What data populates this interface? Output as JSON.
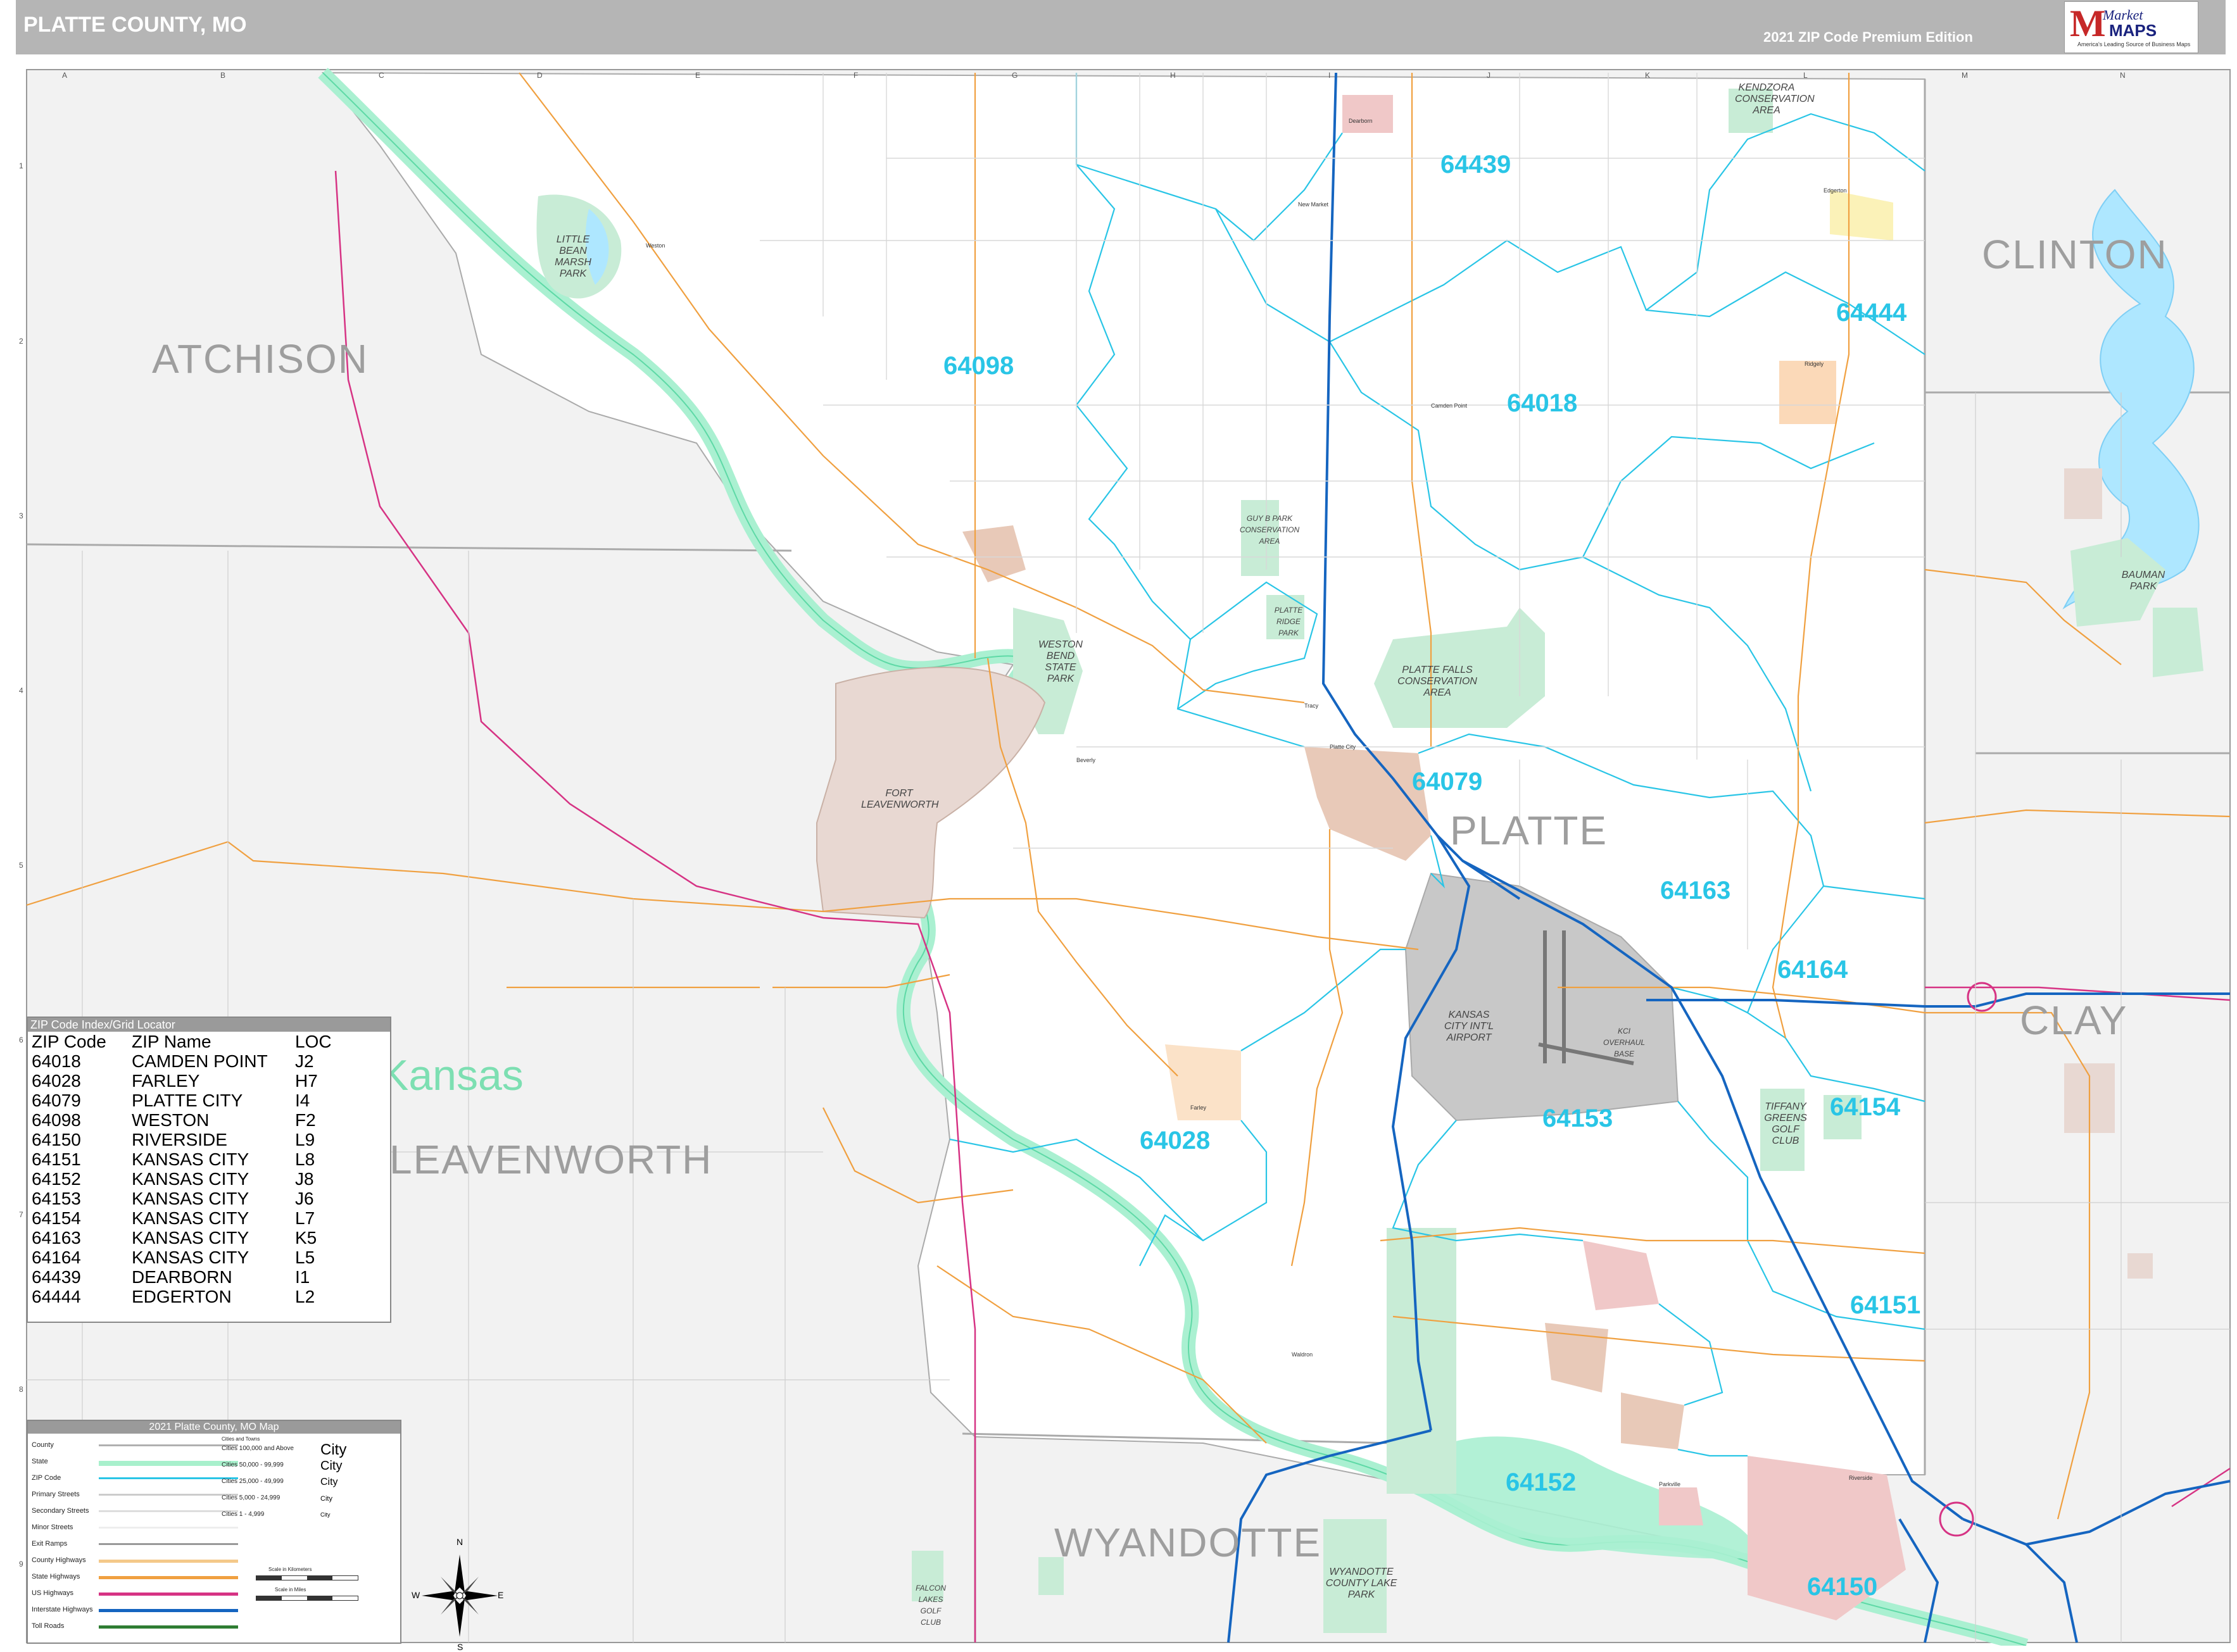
{
  "header": {
    "title": "PLATTE COUNTY, MO",
    "edition": "2021 ZIP Code Premium Edition",
    "logo": {
      "brand_top": "Market",
      "brand_bottom": "MAPS",
      "tagline": "America's Leading Source of Business Maps"
    }
  },
  "grid": {
    "columns": [
      "A",
      "B",
      "C",
      "D",
      "E",
      "F",
      "G",
      "H",
      "I",
      "J",
      "K",
      "L",
      "M",
      "N"
    ],
    "rows": [
      "1",
      "2",
      "3",
      "4",
      "5",
      "6",
      "7",
      "8",
      "9"
    ]
  },
  "counties": {
    "atchison": "ATCHISON",
    "clinton": "CLINTON",
    "platte": "PLATTE",
    "clay": "CLAY",
    "leavenworth": "LEAVENWORTH",
    "wyandotte": "WYANDOTTE"
  },
  "states": {
    "kansas": "Kansas"
  },
  "zip_labels": {
    "z64439": "64439",
    "z64444": "64444",
    "z64098": "64098",
    "z64018": "64018",
    "z64079": "64079",
    "z64163": "64163",
    "z64164": "64164",
    "z64153": "64153",
    "z64154": "64154",
    "z64028": "64028",
    "z64151": "64151",
    "z64152": "64152",
    "z64150": "64150"
  },
  "parks": {
    "kendzora": "KENDZORA CONSERVATION AREA",
    "little_bean": "LITTLE BEAN MARSH PARK",
    "guy_park": "GUY B PARK CONSERVATION AREA",
    "platte_ridge": "PLATTE RIDGE PARK",
    "weston_bend": "WESTON BEND STATE PARK",
    "platte_falls": "PLATTE FALLS CONSERVATION AREA",
    "fort_leavenworth": "FORT LEAVENWORTH",
    "baumann": "BAUMAN PARK",
    "airport": "KANSAS CITY INT'L AIRPORT",
    "kci_base": "KCI OVERHAUL BASE",
    "tiffany": "TIFFANY GREENS GOLF CLUB",
    "wyandotte_lake": "WYANDOTTE COUNTY LAKE PARK",
    "falcon_lakes": "FALCON LAKES GOLF CLUB"
  },
  "towns": {
    "dearborn": "Dearborn",
    "new_market": "New Market",
    "camden_point": "Camden Point",
    "edgerton": "Edgerton",
    "weston": "Weston",
    "beverly": "Beverly",
    "platte_city": "Platte City",
    "tracy": "Tracy",
    "farley": "Farley",
    "ridgely": "Ridgely",
    "waldron": "Waldron",
    "riverside": "Riverside",
    "parkville": "Parkville"
  },
  "zip_index": {
    "title": "ZIP Code Index/Grid Locator",
    "headers": [
      "ZIP Code",
      "ZIP Name",
      "LOC"
    ],
    "rows": [
      [
        "64018",
        "CAMDEN POINT",
        "J2"
      ],
      [
        "64028",
        "FARLEY",
        "H7"
      ],
      [
        "64079",
        "PLATTE CITY",
        "I4"
      ],
      [
        "64098",
        "WESTON",
        "F2"
      ],
      [
        "64150",
        "RIVERSIDE",
        "L9"
      ],
      [
        "64151",
        "KANSAS CITY",
        "L8"
      ],
      [
        "64152",
        "KANSAS CITY",
        "J8"
      ],
      [
        "64153",
        "KANSAS CITY",
        "J6"
      ],
      [
        "64154",
        "KANSAS CITY",
        "L7"
      ],
      [
        "64163",
        "KANSAS CITY",
        "K5"
      ],
      [
        "64164",
        "KANSAS CITY",
        "L5"
      ],
      [
        "64439",
        "DEARBORN",
        "I1"
      ],
      [
        "64444",
        "EDGERTON",
        "L2"
      ]
    ]
  },
  "legend": {
    "title": "2021 Platte County, MO Map",
    "items": [
      "County",
      "State",
      "ZIP Code",
      "Primary Streets",
      "Secondary Streets",
      "Minor Streets",
      "Exit Ramps",
      "County Highways",
      "State Highways",
      "US Highways",
      "Interstate Highways",
      "Toll Roads"
    ],
    "line_colors": [
      "#b0b0b0",
      "#a8f0cc",
      "#29c5e6",
      "#cccccc",
      "#dddddd",
      "#eeeeee",
      "#999999",
      "#f4c98a",
      "#f0a040",
      "#d63384",
      "#1565c0",
      "#2e7d32"
    ],
    "cities_header": "Cities and Towns",
    "cities": [
      "Cities 100,000 and Above",
      "Cities 50,000 - 99,999",
      "Cities 25,000 - 49,999",
      "Cities 5,000 - 24,999",
      "Cities 1 - 4,999"
    ],
    "city_samples": [
      "City",
      "City",
      "City",
      "City",
      "City"
    ],
    "scale_km": "Scale in Kilometers",
    "scale_mi": "Scale in Miles"
  },
  "compass": {
    "n": "N",
    "s": "S",
    "e": "E",
    "w": "W"
  },
  "colors": {
    "header_bg": "#b5b5b5",
    "outside_county": "#f2f2f2",
    "river": "#aaf0d1",
    "zip_boundary": "#29c5e6",
    "state_highway": "#f0a040",
    "us_highway": "#d63384",
    "interstate": "#1565c0",
    "park": "#c8ecd6",
    "urban": "#e8c9b8",
    "airport": "#c8c8c8"
  }
}
